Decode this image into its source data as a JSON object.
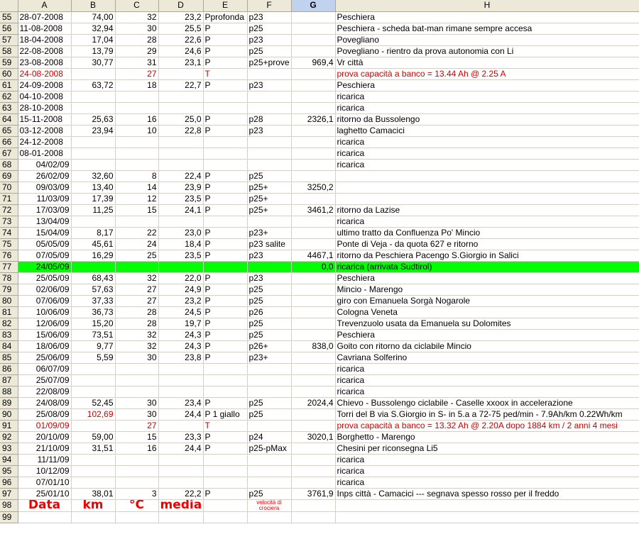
{
  "columns": [
    "",
    "A",
    "B",
    "C",
    "D",
    "E",
    "F",
    "G",
    "H"
  ],
  "selected_column": "G",
  "rows": [
    {
      "n": "55",
      "a": "28-07-2008",
      "b": "74,00",
      "c": "32",
      "d": "23,2",
      "e": "Pprofonda",
      "f": "p23",
      "g": "",
      "h": "Peschiera"
    },
    {
      "n": "56",
      "a": "11-08-2008",
      "b": "32,94",
      "c": "30",
      "d": "25,5",
      "e": "P",
      "f": "p25",
      "g": "",
      "h": "Peschiera   - scheda bat-man rimane sempre accesa"
    },
    {
      "n": "57",
      "a": "18-04-2008",
      "b": "17,04",
      "c": "28",
      "d": "22,6",
      "e": "P",
      "f": "p23",
      "g": "",
      "h": "Povegliano"
    },
    {
      "n": "58",
      "a": "22-08-2008",
      "b": "13,79",
      "c": "29",
      "d": "24,6",
      "e": "P",
      "f": "p25",
      "g": "",
      "h": "Povegliano - rientro da prova autonomia con Li"
    },
    {
      "n": "59",
      "a": "23-08-2008",
      "b": "30,77",
      "c": "31",
      "d": "23,1",
      "e": "P",
      "f": "p25+prove",
      "g": "969,4",
      "h": "Vr città"
    },
    {
      "n": "60",
      "a": "24-08-2008",
      "b": "",
      "c": "27",
      "d": "",
      "e": "T",
      "f": "",
      "g": "",
      "h": "prova capacità a banco = 13.44 Ah  @ 2.25 A",
      "style": "red"
    },
    {
      "n": "61",
      "a": "24-09-2008",
      "b": "63,72",
      "c": "18",
      "d": "22,7",
      "e": "P",
      "f": "p23",
      "g": "",
      "h": "Peschiera"
    },
    {
      "n": "62",
      "a": "04-10-2008",
      "b": "",
      "c": "",
      "d": "",
      "e": "",
      "f": "",
      "g": "",
      "h": "ricarica"
    },
    {
      "n": "63",
      "a": "28-10-2008",
      "b": "",
      "c": "",
      "d": "",
      "e": "",
      "f": "",
      "g": "",
      "h": "ricarica"
    },
    {
      "n": "64",
      "a": "15-11-2008",
      "b": "25,63",
      "c": "16",
      "d": "25,0",
      "e": "P",
      "f": "p28",
      "g": "2326,1",
      "h": "ritorno da Bussolengo"
    },
    {
      "n": "65",
      "a": "03-12-2008",
      "b": "23,94",
      "c": "10",
      "d": "22,8",
      "e": "P",
      "f": "p23",
      "g": "",
      "h": "laghetto Camacici"
    },
    {
      "n": "66",
      "a": "24-12-2008",
      "b": "",
      "c": "",
      "d": "",
      "e": "",
      "f": "",
      "g": "",
      "h": "ricarica"
    },
    {
      "n": "67",
      "a": "08-01-2008",
      "b": "",
      "c": "",
      "d": "",
      "e": "",
      "f": "",
      "g": "",
      "h": "ricarica"
    },
    {
      "n": "68",
      "a": "04/02/09",
      "b": "",
      "c": "",
      "d": "",
      "e": "",
      "f": "",
      "g": "",
      "h": "ricarica",
      "ar": true
    },
    {
      "n": "69",
      "a": "26/02/09",
      "b": "32,60",
      "c": "8",
      "d": "22,4",
      "e": "P",
      "f": "p25",
      "g": "",
      "h": "",
      "ar": true
    },
    {
      "n": "70",
      "a": "09/03/09",
      "b": "13,40",
      "c": "14",
      "d": "23,9",
      "e": "P",
      "f": "p25+",
      "g": "3250,2",
      "h": "",
      "ar": true
    },
    {
      "n": "71",
      "a": "11/03/09",
      "b": "17,39",
      "c": "12",
      "d": "23,5",
      "e": "P",
      "f": "p25+",
      "g": "",
      "h": "",
      "ar": true
    },
    {
      "n": "72",
      "a": "17/03/09",
      "b": "11,25",
      "c": "15",
      "d": "24,1",
      "e": "P",
      "f": "p25+",
      "g": "3461,2",
      "h": "ritorno da Lazise",
      "ar": true
    },
    {
      "n": "73",
      "a": "13/04/09",
      "b": "",
      "c": "",
      "d": "",
      "e": "",
      "f": "",
      "g": "",
      "h": "ricarica",
      "ar": true
    },
    {
      "n": "74",
      "a": "15/04/09",
      "b": "8,17",
      "c": "22",
      "d": "23,0",
      "e": "P",
      "f": "p23+",
      "g": "",
      "h": "ultimo tratto da Confluenza Po' Mincio",
      "ar": true
    },
    {
      "n": "75",
      "a": "05/05/09",
      "b": "45,61",
      "c": "24",
      "d": "18,4",
      "e": "P",
      "f": "p23 salite",
      "g": "",
      "h": "Ponte di Veja - da quota 627 e ritorno",
      "ar": true
    },
    {
      "n": "76",
      "a": "07/05/09",
      "b": "16,29",
      "c": "25",
      "d": "23,5",
      "e": "P",
      "f": "p23",
      "g": "4467,1",
      "h": "ritorno da Peschiera Pacengo S.Giorgio in Salici",
      "ar": true
    },
    {
      "n": "77",
      "a": "24/05/09",
      "b": "",
      "c": "",
      "d": "",
      "e": "",
      "f": "",
      "g": "0,0",
      "h": "ricarica   (arrivata Sudtirol)",
      "ar": true,
      "style": "green"
    },
    {
      "n": "78",
      "a": "25/05/09",
      "b": "68,43",
      "c": "32",
      "d": "22,0",
      "e": "P",
      "f": "p23",
      "g": "",
      "h": "Peschiera",
      "ar": true
    },
    {
      "n": "79",
      "a": "02/06/09",
      "b": "57,63",
      "c": "27",
      "d": "24,9",
      "e": "P",
      "f": "p25",
      "g": "",
      "h": "Mincio - Marengo",
      "ar": true
    },
    {
      "n": "80",
      "a": "07/06/09",
      "b": "37,33",
      "c": "27",
      "d": "23,2",
      "e": "P",
      "f": "p25",
      "g": "",
      "h": "giro con Emanuela Sorgà Nogarole",
      "ar": true
    },
    {
      "n": "81",
      "a": "10/06/09",
      "b": "36,73",
      "c": "28",
      "d": "24,5",
      "e": "P",
      "f": "p26",
      "g": "",
      "h": "Cologna Veneta",
      "ar": true
    },
    {
      "n": "82",
      "a": "12/06/09",
      "b": "15,20",
      "c": "28",
      "d": "19,7",
      "e": "P",
      "f": "p25",
      "g": "",
      "h": "Trevenzuolo  usata da Emanuela su Dolomites",
      "ar": true
    },
    {
      "n": "83",
      "a": "15/06/09",
      "b": "73,51",
      "c": "32",
      "d": "24,3",
      "e": "P",
      "f": "p25",
      "g": "",
      "h": "Peschiera",
      "ar": true
    },
    {
      "n": "84",
      "a": "18/06/09",
      "b": "9,77",
      "c": "32",
      "d": "24,3",
      "e": "P",
      "f": "p26+",
      "g": "838,0",
      "h": "Goito con ritorno da ciclabile Mincio",
      "ar": true
    },
    {
      "n": "85",
      "a": "25/06/09",
      "b": "5,59",
      "c": "30",
      "d": "23,8",
      "e": "P",
      "f": "p23+",
      "g": "",
      "h": "Cavriana Solferino",
      "ar": true
    },
    {
      "n": "86",
      "a": "06/07/09",
      "b": "",
      "c": "",
      "d": "",
      "e": "",
      "f": "",
      "g": "",
      "h": "ricarica",
      "ar": true
    },
    {
      "n": "87",
      "a": "25/07/09",
      "b": "",
      "c": "",
      "d": "",
      "e": "",
      "f": "",
      "g": "",
      "h": "ricarica",
      "ar": true
    },
    {
      "n": "88",
      "a": "22/08/09",
      "b": "",
      "c": "",
      "d": "",
      "e": "",
      "f": "",
      "g": "",
      "h": "ricarica",
      "ar": true
    },
    {
      "n": "89",
      "a": "24/08/09",
      "b": "52,45",
      "c": "30",
      "d": "23,4",
      "e": "P",
      "f": "p25",
      "g": "2024,4",
      "h": "Chievo - Bussolengo ciclabile - Caselle    xxoox in accelerazione",
      "ar": true
    },
    {
      "n": "90",
      "a": "25/08/09",
      "b": "102,69",
      "c": "30",
      "d": "24,4",
      "e": "P  1 giallo",
      "f": "p25",
      "g": "",
      "h": "Torri del B via S.Giorgio in S- in 5.a a 72-75 ped/min - 7.9Ah/km 0.22Wh/km",
      "ar": true,
      "bred": true
    },
    {
      "n": "91",
      "a": "01/09/09",
      "b": "",
      "c": "27",
      "d": "",
      "e": "T",
      "f": "",
      "g": "",
      "h": "prova capacità a banco = 13.32 Ah  @ 2.20A    dopo 1884 km / 2 anni 4 mesi",
      "ar": true,
      "style": "red"
    },
    {
      "n": "92",
      "a": "20/10/09",
      "b": "59,00",
      "c": "15",
      "d": "23,3",
      "e": "P",
      "f": "p24",
      "g": "3020,1",
      "h": "Borghetto - Marengo",
      "ar": true
    },
    {
      "n": "93",
      "a": "21/10/09",
      "b": "31,51",
      "c": "16",
      "d": "24,4",
      "e": "P",
      "f": "p25-pMax",
      "g": "",
      "h": "Chesini per riconsegna Li5",
      "ar": true
    },
    {
      "n": "94",
      "a": "11/11/09",
      "b": "",
      "c": "",
      "d": "",
      "e": "",
      "f": "",
      "g": "",
      "h": "ricarica",
      "ar": true
    },
    {
      "n": "95",
      "a": "10/12/09",
      "b": "",
      "c": "",
      "d": "",
      "e": "",
      "f": "",
      "g": "",
      "h": "ricarica",
      "ar": true
    },
    {
      "n": "96",
      "a": "07/01/10",
      "b": "",
      "c": "",
      "d": "",
      "e": "",
      "f": "",
      "g": "",
      "h": "ricarica",
      "ar": true
    },
    {
      "n": "97",
      "a": "25/01/10",
      "b": "38,01",
      "c": "3",
      "d": "22,2",
      "e": "P",
      "f": "p25",
      "g": "3761,9",
      "h": "Inps città - Camacici    --- segnava spesso rosso per il freddo",
      "ar": true
    }
  ],
  "legend_row": {
    "n": "98",
    "a": "Data",
    "b": "km",
    "c": "°C",
    "d": "media",
    "f": "velocità di crociera"
  },
  "last_row": {
    "n": "99"
  },
  "colors": {
    "header_bg": "#ece9d8",
    "selected_header_bg": "#c1d2ee",
    "grid": "#d4d0c8",
    "red_text": "#cc0000",
    "green_fill": "#00ff00"
  }
}
